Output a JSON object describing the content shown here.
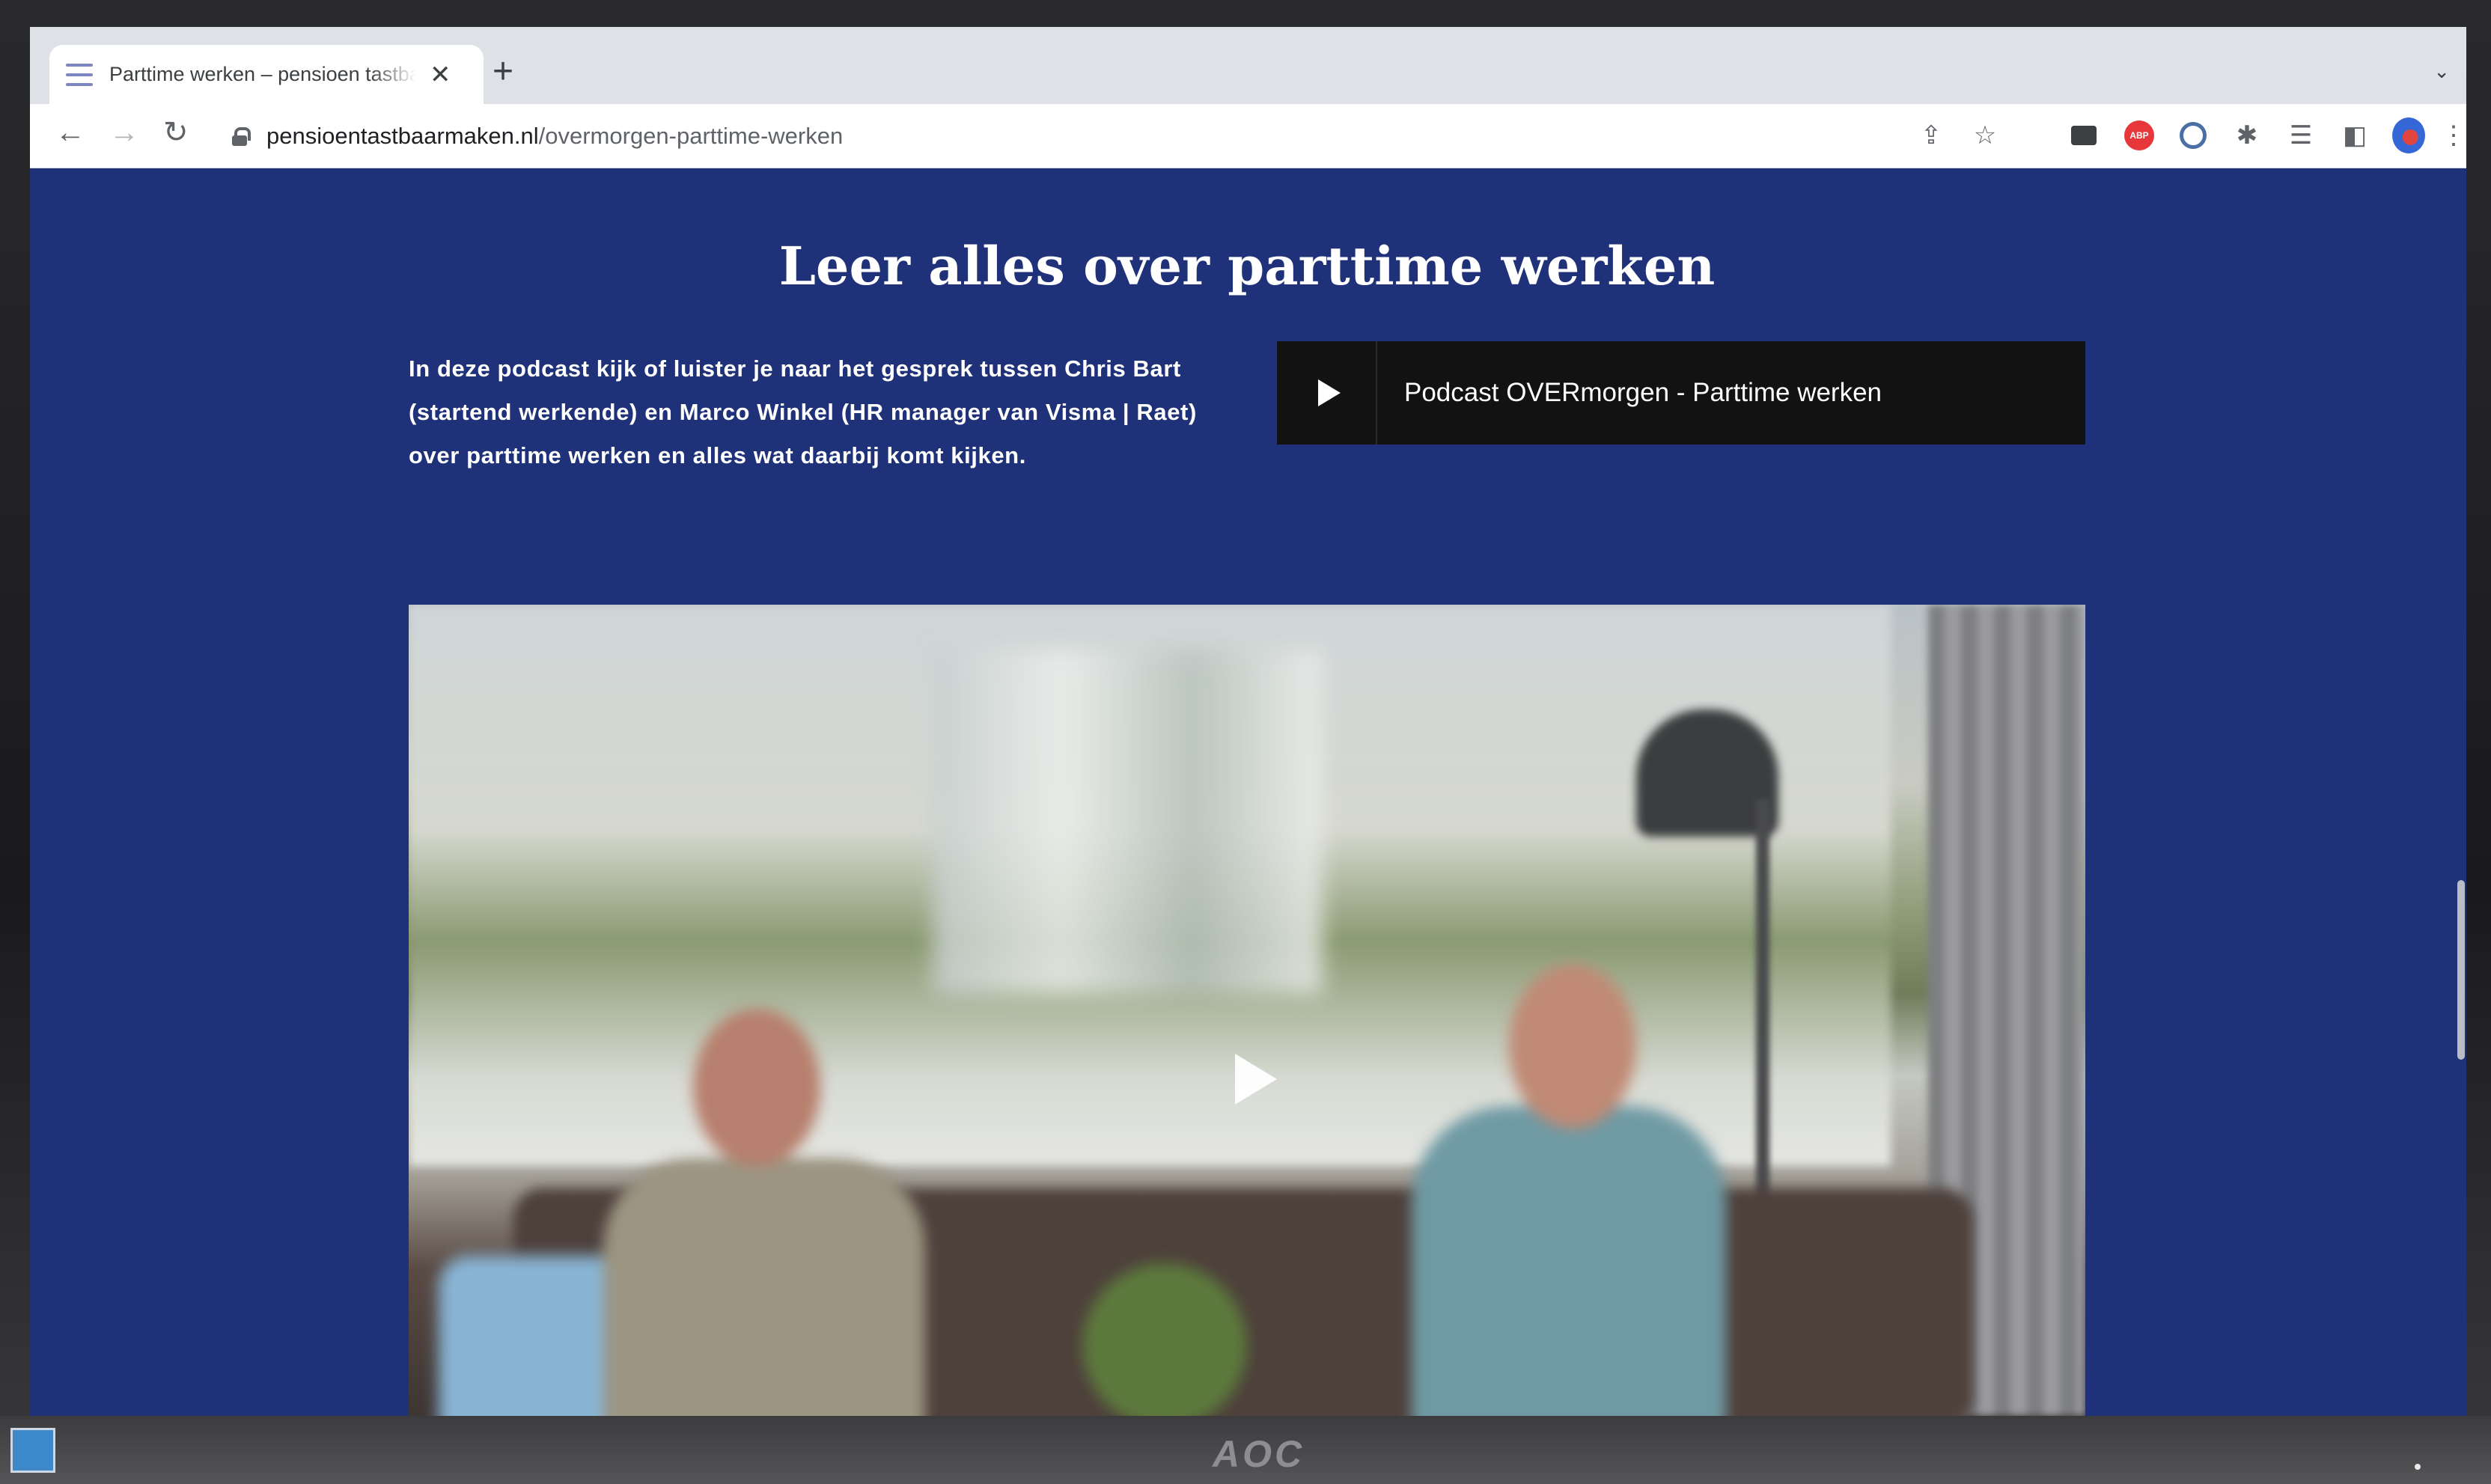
{
  "browser": {
    "tab_title": "Parttime werken – pensioen tastbaar maken",
    "tab_close": "✕",
    "new_tab": "+",
    "tab_menu": "⌄",
    "url_host": "pensioentastbaarmaken.nl",
    "url_path": "/overmorgen-parttime-werken",
    "ext_red_label": "ABP"
  },
  "page": {
    "heading": "Leer alles over parttime werken",
    "intro": "In deze podcast kijk of luister je naar het gesprek tussen Chris Bart (startend werkende) en Marco Winkel (HR manager van Visma | Raet) over parttime werken en alles wat daarbij komt kijken.",
    "podcast_title": "Podcast OVERmorgen - Parttime werken"
  },
  "monitor": {
    "brand": "AOC"
  },
  "colors": {
    "page_background": "#1f3279",
    "player_background": "#121212",
    "text": "#ffffff"
  }
}
